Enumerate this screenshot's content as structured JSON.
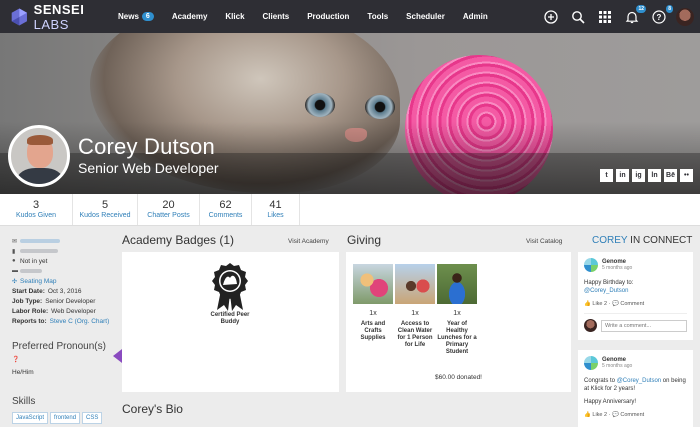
{
  "topnav": {
    "logo_bold": "SENSEI",
    "logo_thin": "LABS",
    "items": [
      {
        "label": "News",
        "badge": "6"
      },
      {
        "label": "Academy"
      },
      {
        "label": "Klick"
      },
      {
        "label": "Clients"
      },
      {
        "label": "Production"
      },
      {
        "label": "Tools"
      },
      {
        "label": "Scheduler"
      },
      {
        "label": "Admin"
      }
    ],
    "icons": [
      "plus-circle-icon",
      "search-icon",
      "apps-grid-icon",
      "bell-icon",
      "help-icon",
      "user-avatar"
    ],
    "bell_badge": "12",
    "help_badge": "8"
  },
  "profile": {
    "name": "Corey Dutson",
    "title": "Senior Web Developer",
    "socials": [
      "t",
      "in",
      "ig",
      "ln",
      "Bē",
      "••"
    ]
  },
  "stats": [
    {
      "num": "3",
      "label": "Kudos Given"
    },
    {
      "num": "5",
      "label": "Kudos Received"
    },
    {
      "num": "20",
      "label": "Chatter Posts"
    },
    {
      "num": "62",
      "label": "Comments"
    },
    {
      "num": "41",
      "label": "Likes"
    }
  ],
  "info": {
    "status": "Not in yet",
    "seating_map": "Seating Map",
    "start_date_label": "Start Date:",
    "start_date": "Oct 3, 2016",
    "job_type_label": "Job Type:",
    "job_type": "Senior Developer",
    "labor_role_label": "Labor Role:",
    "labor_role": "Web Developer",
    "reports_label": "Reports to:",
    "reports_to": "Steve C",
    "org_chart": "(Org. Chart)"
  },
  "pronouns": {
    "heading": "Preferred Pronoun(s)",
    "value": "He/Him"
  },
  "skills": {
    "heading": "Skills",
    "items": [
      "JavaScript",
      "frontend",
      "CSS"
    ]
  },
  "academy": {
    "title": "Academy Badges (1)",
    "link": "Visit Academy",
    "badge_name": "Certified Peer Buddy"
  },
  "giving": {
    "title": "Giving",
    "link": "Visit Catalog",
    "items": [
      {
        "count": "1x",
        "label": "Arts and Crafts Supplies"
      },
      {
        "count": "1x",
        "label": "Access to Clean Water for 1 Person for Life"
      },
      {
        "count": "1x",
        "label": "Year of Healthy Lunches for a Primary Student"
      }
    ],
    "donated": "$60.00 donated!"
  },
  "connect": {
    "title_blue": "COREY",
    "title_rest": " IN CONNECT",
    "posts": [
      {
        "author": "Genome",
        "time": "5 months ago",
        "body_prefix": "Happy Birthday to: ",
        "mention": "@Corey_Dutson",
        "body_suffix": "",
        "likes": "Like 2",
        "comment": "Comment",
        "comment_placeholder": "Write a comment..."
      },
      {
        "author": "Genome",
        "time": "5 months ago",
        "body_prefix": "Congrats to ",
        "mention": "@Corey_Dutson",
        "body_suffix": " on being at Klick for 2 years!",
        "extra": "Happy Anniversary!",
        "likes": "Like 2",
        "comment": "Comment"
      }
    ]
  },
  "bio": {
    "title": "Corey's Bio"
  },
  "colors": {
    "nav_bg": "#2e2e34",
    "link_blue": "#2f7fb8",
    "badge_blue": "#2f8fce",
    "arrow_purple": "#8a4bc0",
    "yarn_pink": "#f45aa4"
  }
}
